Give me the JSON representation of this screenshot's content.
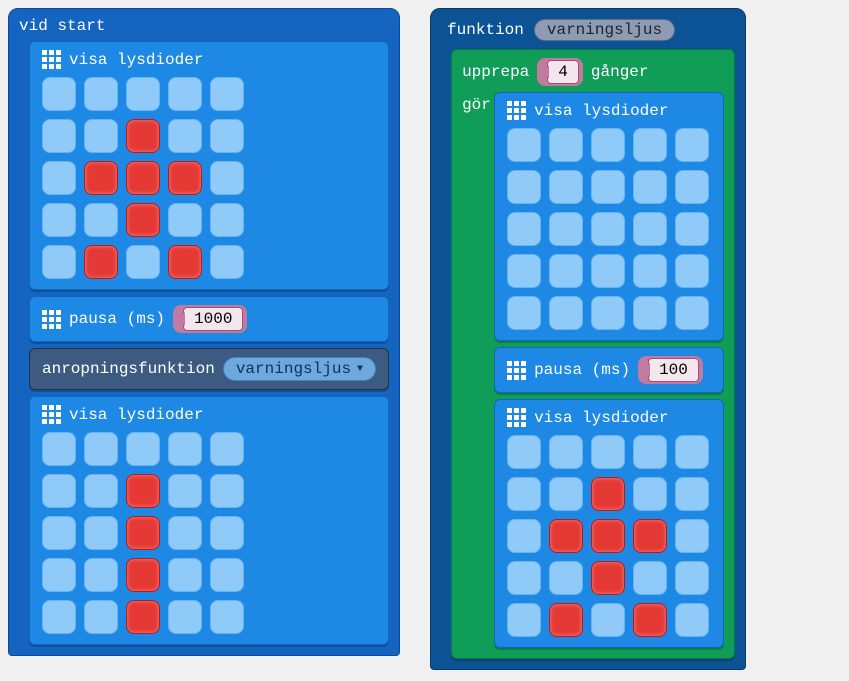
{
  "onstart": {
    "label": "vid start",
    "show_leds_label": "visa lysdioder",
    "grid1": [
      [
        0,
        0,
        0,
        0,
        0
      ],
      [
        0,
        0,
        1,
        0,
        0
      ],
      [
        0,
        1,
        1,
        1,
        0
      ],
      [
        0,
        0,
        1,
        0,
        0
      ],
      [
        0,
        1,
        0,
        1,
        0
      ]
    ],
    "pause_label": "pausa (ms)",
    "pause_value": "1000",
    "call_label": "anropningsfunktion",
    "call_fn": "varningsljus",
    "grid2": [
      [
        0,
        0,
        0,
        0,
        0
      ],
      [
        0,
        0,
        1,
        0,
        0
      ],
      [
        0,
        0,
        1,
        0,
        0
      ],
      [
        0,
        0,
        1,
        0,
        0
      ],
      [
        0,
        0,
        1,
        0,
        0
      ]
    ]
  },
  "fn": {
    "label": "funktion",
    "name": "varningsljus",
    "repeat_label": "upprepa",
    "repeat_times_label": "gånger",
    "repeat_count": "4",
    "do_label": "gör",
    "show_leds_label": "visa lysdioder",
    "grid1": [
      [
        0,
        0,
        0,
        0,
        0
      ],
      [
        0,
        0,
        0,
        0,
        0
      ],
      [
        0,
        0,
        0,
        0,
        0
      ],
      [
        0,
        0,
        0,
        0,
        0
      ],
      [
        0,
        0,
        0,
        0,
        0
      ]
    ],
    "pause_label": "pausa (ms)",
    "pause_value": "100",
    "grid2": [
      [
        0,
        0,
        0,
        0,
        0
      ],
      [
        0,
        0,
        1,
        0,
        0
      ],
      [
        0,
        1,
        1,
        1,
        0
      ],
      [
        0,
        0,
        1,
        0,
        0
      ],
      [
        0,
        1,
        0,
        1,
        0
      ]
    ]
  }
}
